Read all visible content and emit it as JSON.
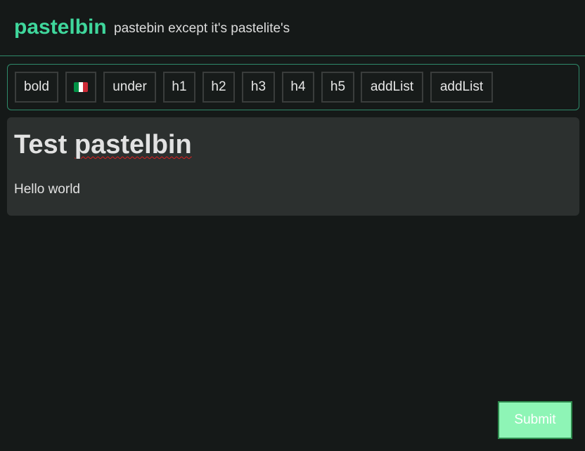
{
  "header": {
    "brand": "pastelbin",
    "tagline": "pastebin except it's pastelite's"
  },
  "toolbar": {
    "buttons": [
      {
        "label": "bold"
      },
      {
        "label": "",
        "icon": "italy-flag-icon",
        "colors": [
          "#009246",
          "#ffffff",
          "#ce2b37"
        ]
      },
      {
        "label": "under"
      },
      {
        "label": "h1"
      },
      {
        "label": "h2"
      },
      {
        "label": "h3"
      },
      {
        "label": "h4"
      },
      {
        "label": "h5"
      },
      {
        "label": "addList"
      },
      {
        "label": "addList"
      }
    ]
  },
  "editor": {
    "heading_word1": "Test",
    "heading_word2": "pastelbin",
    "body": "Hello world"
  },
  "submit": {
    "label": "Submit"
  },
  "colors": {
    "accent": "#3fd79c",
    "background": "#151918",
    "editor_bg": "#2c302f",
    "submit_bg": "#8ef5b6"
  }
}
